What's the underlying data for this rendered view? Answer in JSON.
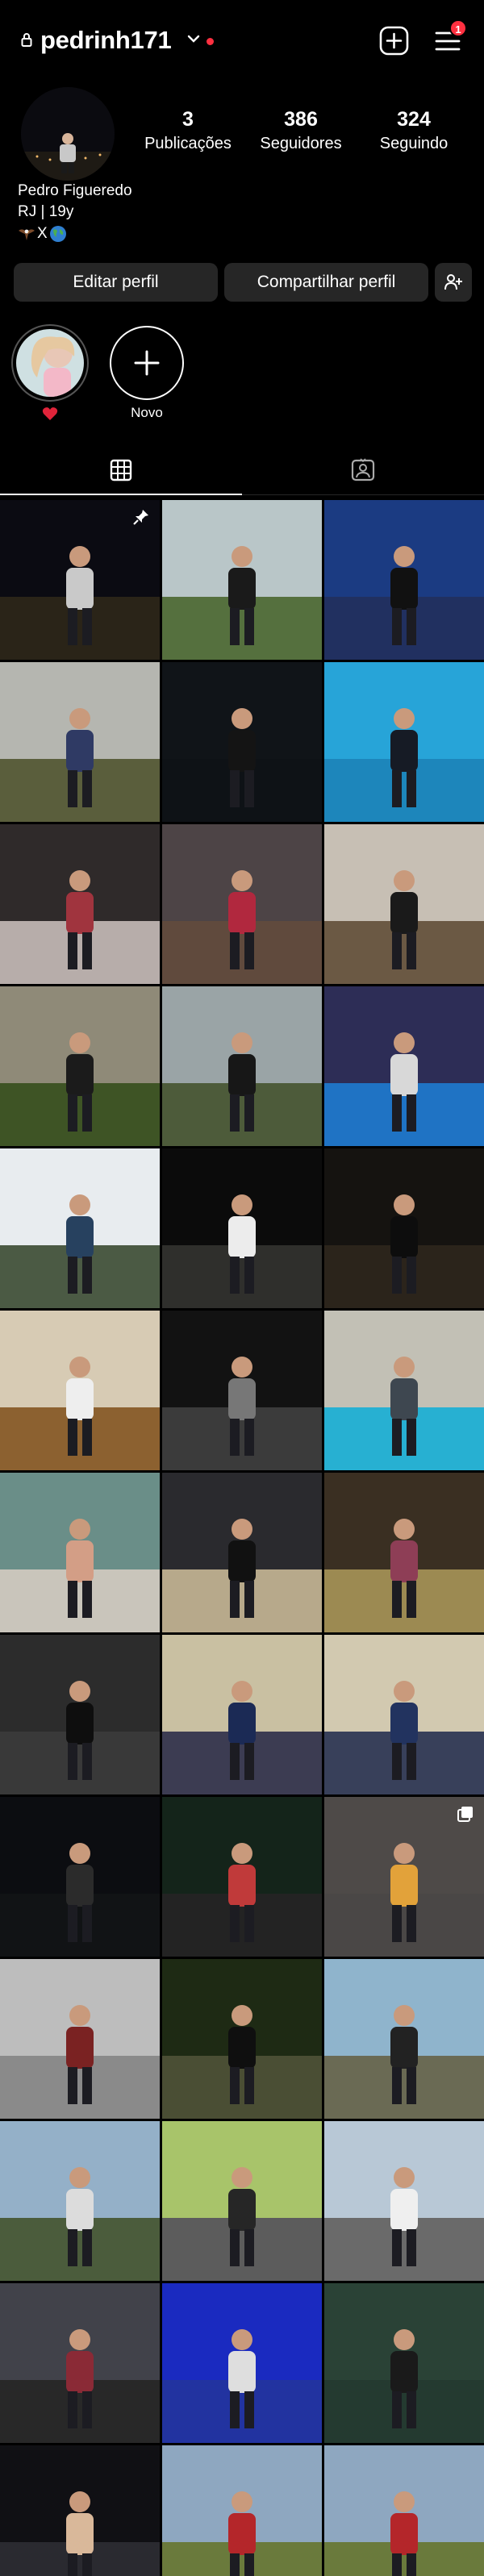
{
  "header": {
    "username": "pedrinh171",
    "notification_count": "1",
    "accent_color": "#ff3040"
  },
  "profile": {
    "stats": [
      {
        "value": "3",
        "label": "Publicações"
      },
      {
        "value": "386",
        "label": "Seguidores"
      },
      {
        "value": "324",
        "label": "Seguindo"
      }
    ],
    "full_name": "Pedro Figueredo",
    "bio_line1": "RJ | 19y",
    "bio_line2_text": "X",
    "bio_line2_icons": [
      "eagle-emoji",
      "globe-emoji"
    ]
  },
  "actions": {
    "edit_label": "Editar perfil",
    "share_label": "Compartilhar perfil"
  },
  "highlights": {
    "items": [
      {
        "label": "❤️",
        "icon": "heart-emoji"
      },
      {
        "label": "Novo",
        "icon": "plus-icon"
      }
    ]
  },
  "tabs": [
    {
      "name": "posts-grid",
      "icon": "grid-icon",
      "active": true
    },
    {
      "name": "tagged",
      "icon": "tagged-person-icon",
      "active": false
    }
  ],
  "posts": [
    {
      "badge": "pin-icon",
      "sky": "#0b0b12",
      "ground": "#2a2418",
      "figure": "#c9c9c9"
    },
    {
      "badge": "",
      "sky": "#b9c6c8",
      "ground": "#55703e",
      "figure": "#1a1a1a"
    },
    {
      "badge": "",
      "sky": "#1b3b82",
      "ground": "#213060",
      "figure": "#111111"
    },
    {
      "badge": "",
      "sky": "#b5b6b0",
      "ground": "#5a5e3c",
      "figure": "#2f3a64"
    },
    {
      "badge": "",
      "sky": "#101418",
      "ground": "#0e1216",
      "figure": "#141414"
    },
    {
      "badge": "",
      "sky": "#27a4d8",
      "ground": "#1d86bb",
      "figure": "#161b25"
    },
    {
      "badge": "",
      "sky": "#2f2a2a",
      "ground": "#b7adaa",
      "figure": "#a0343e"
    },
    {
      "badge": "",
      "sky": "#4d4446",
      "ground": "#604a3d",
      "figure": "#b1283e"
    },
    {
      "badge": "",
      "sky": "#c7bfb4",
      "ground": "#6b5944",
      "figure": "#1a1a1a"
    },
    {
      "badge": "",
      "sky": "#8f8a78",
      "ground": "#3e5425",
      "figure": "#1b1b1b"
    },
    {
      "badge": "",
      "sky": "#9aa4a6",
      "ground": "#4d5b3a",
      "figure": "#171717"
    },
    {
      "badge": "",
      "sky": "#2d2d56",
      "ground": "#1f73c4",
      "figure": "#d8d8d8"
    },
    {
      "badge": "",
      "sky": "#e8ecef",
      "ground": "#4b5a44",
      "figure": "#27415f"
    },
    {
      "badge": "",
      "sky": "#0b0b0b",
      "ground": "#2f2f2c",
      "figure": "#ececec"
    },
    {
      "badge": "",
      "sky": "#151310",
      "ground": "#2b241b",
      "figure": "#0d0d0d"
    },
    {
      "badge": "",
      "sky": "#d7cbb4",
      "ground": "#8c6130",
      "figure": "#eeeeee"
    },
    {
      "badge": "",
      "sky": "#121212",
      "ground": "#3b3b3b",
      "figure": "#777777"
    },
    {
      "badge": "",
      "sky": "#c2c0b5",
      "ground": "#27b0d2",
      "figure": "#3e4750"
    },
    {
      "badge": "",
      "sky": "#6a8e88",
      "ground": "#c9c5bb",
      "figure": "#d39e86"
    },
    {
      "badge": "",
      "sky": "#2a2a2e",
      "ground": "#b7a98b",
      "figure": "#111111"
    },
    {
      "badge": "",
      "sky": "#3a2f22",
      "ground": "#9c8a52",
      "figure": "#8e3e56"
    },
    {
      "badge": "",
      "sky": "#2c2c2c",
      "ground": "#393939",
      "figure": "#0e0e0e"
    },
    {
      "badge": "",
      "sky": "#c9c0a2",
      "ground": "#3c3c52",
      "figure": "#1b2a55"
    },
    {
      "badge": "",
      "sky": "#d2c9b0",
      "ground": "#38405a",
      "figure": "#22335f"
    },
    {
      "badge": "",
      "sky": "#0c0d11",
      "ground": "#111315",
      "figure": "#2b2b2b"
    },
    {
      "badge": "",
      "sky": "#14241a",
      "ground": "#232323",
      "figure": "#c03a3a"
    },
    {
      "badge": "carousel-icon",
      "sky": "#4e4a48",
      "ground": "#4a4746",
      "figure": "#e2a23a"
    },
    {
      "badge": "",
      "sky": "#bdbdbd",
      "ground": "#8a8a8a",
      "figure": "#7a2222"
    },
    {
      "badge": "",
      "sky": "#1e2a14",
      "ground": "#4a4e34",
      "figure": "#0f0f0f"
    },
    {
      "badge": "",
      "sky": "#8fb4cc",
      "ground": "#6a6a54",
      "figure": "#222222"
    },
    {
      "badge": "",
      "sky": "#94b0c8",
      "ground": "#4b5c3c",
      "figure": "#dcdcdc"
    },
    {
      "badge": "",
      "sky": "#a8c46a",
      "ground": "#5c5c5c",
      "figure": "#262626"
    },
    {
      "badge": "",
      "sky": "#b8c8d6",
      "ground": "#6a6a6a",
      "figure": "#efefef"
    },
    {
      "badge": "",
      "sky": "#41424a",
      "ground": "#282828",
      "figure": "#8a2a36"
    },
    {
      "badge": "",
      "sky": "#1a2ac0",
      "ground": "#2233a0",
      "figure": "#dedede"
    },
    {
      "badge": "",
      "sky": "#2a4236",
      "ground": "#243a30",
      "figure": "#1a1a1a"
    },
    {
      "badge": "",
      "sky": "#101014",
      "ground": "#2a2a30",
      "figure": "#d9b89a"
    },
    {
      "badge": "",
      "sky": "#8ea7c0",
      "ground": "#6a7a3c",
      "figure": "#b4262a"
    },
    {
      "badge": "",
      "sky": "#8ea7c0",
      "ground": "#6a7a3c",
      "figure": "#b4262a"
    }
  ]
}
